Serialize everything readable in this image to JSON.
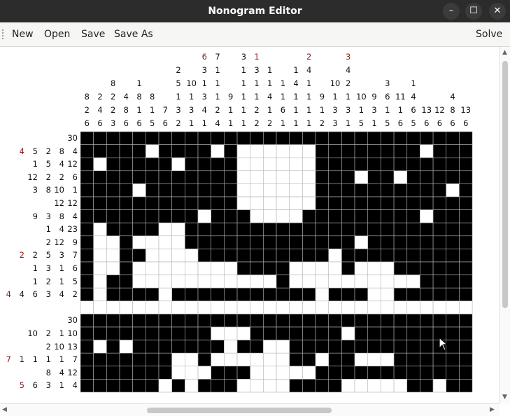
{
  "window": {
    "title": "Nonogram Editor",
    "minimize": "–",
    "maximize": "☐",
    "close": "✕"
  },
  "menu": {
    "new": "New",
    "open": "Open",
    "save": "Save",
    "save_as": "Save As",
    "solve": "Solve"
  },
  "puzzle": {
    "cols": [
      [
        "8",
        "2",
        "6"
      ],
      [
        "2",
        "4",
        "6"
      ],
      [
        "8",
        "2",
        "2",
        "3"
      ],
      [
        "4",
        "8",
        "6"
      ],
      [
        "1",
        "8",
        "1",
        "6"
      ],
      [
        "8",
        "1",
        "5"
      ],
      [
        "7",
        "6"
      ],
      [
        "2",
        "5",
        "1",
        "3",
        "2"
      ],
      [
        "10",
        "1",
        "3",
        "1"
      ],
      [
        "6",
        "3",
        "1",
        "3",
        "4",
        "1"
      ],
      [
        "1",
        "7",
        "1",
        "1",
        "1",
        "2",
        "4"
      ],
      [
        "9",
        "1",
        "1"
      ],
      [
        "2",
        "3",
        "1",
        "1",
        "1",
        "1",
        "1"
      ],
      [
        "1",
        "3",
        "1",
        "1",
        "2",
        "2"
      ],
      [
        "1",
        "1",
        "4",
        "1",
        "2"
      ],
      [
        "1",
        "1",
        "6",
        "1"
      ],
      [
        "1",
        "4",
        "1",
        "1",
        "1"
      ],
      [
        "2",
        "4",
        "1",
        "1",
        "1",
        "1"
      ],
      [
        "9",
        "1",
        "2"
      ],
      [
        "10",
        "1",
        "3",
        "3"
      ],
      [
        "3",
        "4",
        "2",
        "1",
        "3",
        "1"
      ],
      [
        "10",
        "1",
        "5"
      ],
      [
        "9",
        "3",
        "1"
      ],
      [
        "3",
        "6",
        "1",
        "5"
      ],
      [
        "11",
        "1",
        "6"
      ],
      [
        "1",
        "4",
        "6",
        "5"
      ],
      [
        "13",
        "6"
      ],
      [
        "12",
        "6"
      ],
      [
        "4",
        "8",
        "6"
      ],
      [
        "13",
        "6"
      ]
    ],
    "rows": [
      [
        "30"
      ],
      [
        "4",
        "5",
        "2",
        "8",
        "4"
      ],
      [
        "1",
        "5",
        "4",
        "12"
      ],
      [
        "12",
        "2",
        "2",
        "6"
      ],
      [
        "3",
        "8",
        "10",
        "1"
      ],
      [
        "12",
        "12"
      ],
      [
        "9",
        "3",
        "8",
        "4"
      ],
      [
        "1",
        "4",
        "23"
      ],
      [
        "2",
        "12",
        "9"
      ],
      [
        "2",
        "2",
        "5",
        "3",
        "7"
      ],
      [
        "1",
        "3",
        "1",
        "6"
      ],
      [
        "1",
        "2",
        "1",
        "5"
      ],
      [
        "4",
        "4",
        "6",
        "3",
        "4",
        "2"
      ],
      [],
      [
        "30"
      ],
      [
        "10",
        "2",
        "1",
        "10"
      ],
      [
        "2",
        "10",
        "13"
      ],
      [
        "7",
        "1",
        "1",
        "1",
        "1",
        "7"
      ],
      [
        "8",
        "4",
        "12"
      ],
      [
        "5",
        "6",
        "3",
        "1",
        "4"
      ]
    ],
    "grid": [
      "111111111111111111111111111111",
      "111110111101000000111111110111",
      "101111101111000000111111111111",
      "111111111111000000111011011111",
      "111101111111000000111111111101",
      "111111111111000000111111111111",
      "111111111011100001111111110111",
      "101111001111111111111111111111",
      "100100001111111111111011111111",
      "100110000111111111101111111111",
      "100100000000111100001000111111",
      "101100000000000100000000001111",
      "101111011111111111011100111111",
      "000000000000000000000000000000",
      "111111111111111111111111111111",
      "111111111100011111110111111111",
      "101011111110110011111111111111",
      "111111100100000011011000111111",
      "111111100011100000111111111111",
      "111111010111000011110000011011"
    ]
  }
}
